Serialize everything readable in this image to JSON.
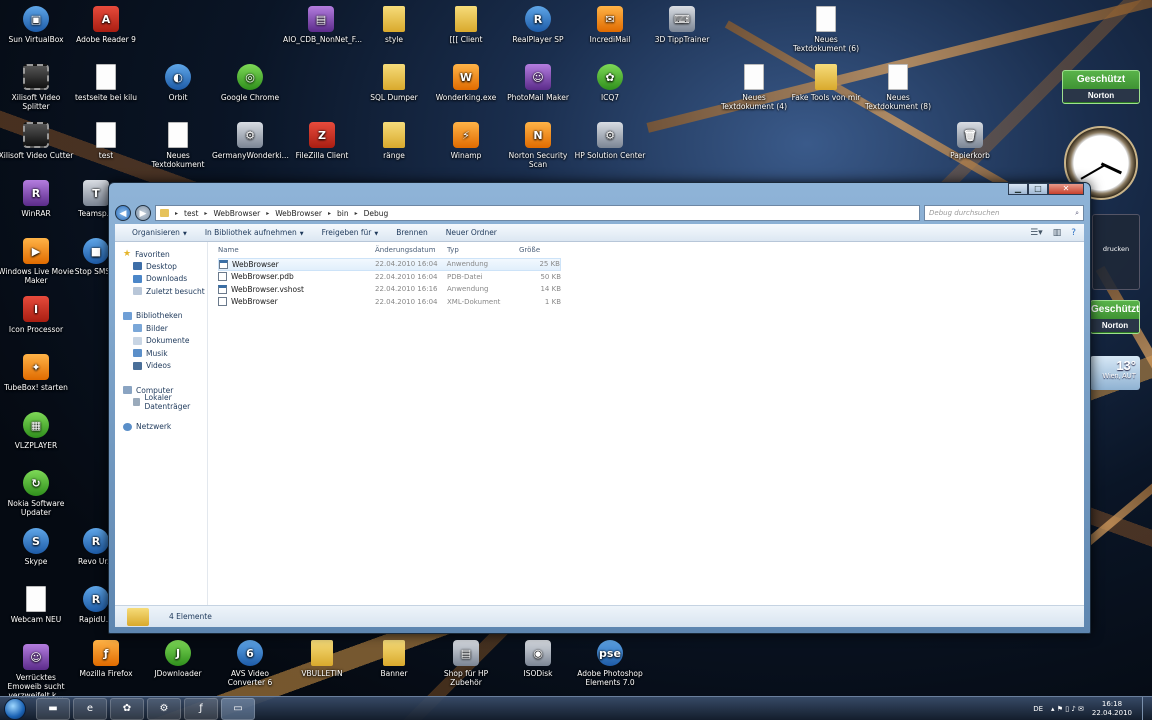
{
  "desktop": {
    "icons_top": [
      {
        "label": "Sun VirtualBox",
        "style": "blue",
        "glyph": "▣"
      },
      {
        "label": "Adobe Reader 9",
        "style": "red",
        "glyph": "A"
      },
      {
        "label": "AIO_CDB_NonNet_F...",
        "style": "purple",
        "glyph": "▤"
      },
      {
        "label": "style",
        "style": "folder",
        "glyph": ""
      },
      {
        "label": "[[[ Client",
        "style": "folder",
        "glyph": ""
      },
      {
        "label": "RealPlayer SP",
        "style": "blue",
        "glyph": "R"
      },
      {
        "label": "IncrediMail",
        "style": "orange",
        "glyph": "✉"
      },
      {
        "label": "3D TippTrainer",
        "style": "gray",
        "glyph": "⌨"
      },
      {
        "label": "Neues Textdokument (6)",
        "style": "doc",
        "glyph": ""
      }
    ],
    "icons_row2": [
      {
        "label": "Xilisoft Video Splitter",
        "style": "film",
        "glyph": ""
      },
      {
        "label": "testseite bei kilu",
        "style": "doc",
        "glyph": ""
      },
      {
        "label": "Orbit",
        "style": "blue",
        "glyph": "◐"
      },
      {
        "label": "Google Chrome",
        "style": "green",
        "glyph": "◎"
      },
      {
        "label": "SQL Dumper",
        "style": "folder",
        "glyph": ""
      },
      {
        "label": "Wonderking.exe",
        "style": "orange",
        "glyph": "W"
      },
      {
        "label": "PhotoMail Maker",
        "style": "purple",
        "glyph": "☺"
      },
      {
        "label": "ICQ7",
        "style": "green",
        "glyph": "✿"
      },
      {
        "label": "Neues Textdokument (4)",
        "style": "doc",
        "glyph": ""
      },
      {
        "label": "Fake Tools von mir",
        "style": "folder",
        "glyph": ""
      },
      {
        "label": "Neues Textdokument (8)",
        "style": "doc",
        "glyph": ""
      }
    ],
    "icons_row3": [
      {
        "label": "Xilisoft Video Cutter",
        "style": "film",
        "glyph": ""
      },
      {
        "label": "test",
        "style": "doc",
        "glyph": ""
      },
      {
        "label": "Neues Textdokument",
        "style": "doc",
        "glyph": ""
      },
      {
        "label": "GermanyWonderki...",
        "style": "gray",
        "glyph": "⚙"
      },
      {
        "label": "FileZilla Client",
        "style": "red",
        "glyph": "Z"
      },
      {
        "label": "ränge",
        "style": "folder",
        "glyph": ""
      },
      {
        "label": "Winamp",
        "style": "orange",
        "glyph": "⚡"
      },
      {
        "label": "Norton Security Scan",
        "style": "orange",
        "glyph": "N"
      },
      {
        "label": "HP Solution Center",
        "style": "gray",
        "glyph": "⚙"
      },
      {
        "label": "Papierkorb",
        "style": "gray",
        "glyph": "🗑"
      }
    ],
    "icons_left": [
      {
        "label": "WinRAR",
        "style": "purple",
        "glyph": "R"
      },
      {
        "label": "Windows Live Movie Maker",
        "style": "orange",
        "glyph": "▶"
      },
      {
        "label": "Icon Processor",
        "style": "red",
        "glyph": "I"
      },
      {
        "label": "TubeBox! starten",
        "style": "orange",
        "glyph": "✦"
      },
      {
        "label": "VLZPLAYER",
        "style": "green",
        "glyph": "▦"
      },
      {
        "label": "Nokia Software Updater",
        "style": "green",
        "glyph": "↻"
      },
      {
        "label": "Skype",
        "style": "blue",
        "glyph": "S"
      },
      {
        "label": "Webcam NEU",
        "style": "doc",
        "glyph": ""
      },
      {
        "label": "Verrücktes Emoweib sucht verzweifelt k...",
        "style": "purple",
        "glyph": "☺"
      }
    ],
    "icons_left2": [
      {
        "label": "Teamsp...",
        "style": "gray",
        "glyph": "T"
      },
      {
        "label": "Stop SMS...",
        "style": "blue",
        "glyph": "■"
      },
      {
        "label": "Revo Ur...",
        "style": "blue",
        "glyph": "R"
      },
      {
        "label": "RapidU...",
        "style": "blue",
        "glyph": "R"
      }
    ],
    "icons_bottom": [
      {
        "label": "Mozilla Firefox",
        "style": "orange",
        "glyph": "ƒ"
      },
      {
        "label": "JDownloader",
        "style": "green",
        "glyph": "J"
      },
      {
        "label": "AVS Video Converter 6",
        "style": "blue",
        "glyph": "6"
      },
      {
        "label": "VBULLETIN",
        "style": "folder",
        "glyph": ""
      },
      {
        "label": "Banner",
        "style": "folder",
        "glyph": ""
      },
      {
        "label": "Shop für HP Zubehör",
        "style": "gray",
        "glyph": "▤"
      },
      {
        "label": "ISODisk",
        "style": "gray",
        "glyph": "◉"
      },
      {
        "label": "Adobe Photoshop Elements 7.0",
        "style": "blue",
        "glyph": "pse"
      }
    ]
  },
  "gadgets": {
    "norton1": {
      "status": "Geschützt",
      "brand": "Norton"
    },
    "norton2": {
      "status": "Geschützt",
      "brand": "Norton"
    },
    "weather": {
      "temp": "13°",
      "city": "Wien, AUT"
    },
    "print_label": "drucken"
  },
  "explorer": {
    "breadcrumb": [
      "test",
      "WebBrowser",
      "WebBrowser",
      "bin",
      "Debug"
    ],
    "search_placeholder": "Debug durchsuchen",
    "toolbar": [
      {
        "label": "Organisieren",
        "dropdown": true
      },
      {
        "label": "In Bibliothek aufnehmen",
        "dropdown": true
      },
      {
        "label": "Freigeben für",
        "dropdown": true
      },
      {
        "label": "Brennen",
        "dropdown": false
      },
      {
        "label": "Neuer Ordner",
        "dropdown": false
      }
    ],
    "nav": {
      "favorites": "Favoriten",
      "favorites_items": [
        "Desktop",
        "Downloads",
        "Zuletzt besucht"
      ],
      "libraries": "Bibliotheken",
      "libraries_items": [
        "Bilder",
        "Dokumente",
        "Musik",
        "Videos"
      ],
      "computer": "Computer",
      "computer_items": [
        "Lokaler Datenträger"
      ],
      "network": "Netzwerk"
    },
    "columns": {
      "name": "Name",
      "date": "Änderungsdatum",
      "type": "Typ",
      "size": "Größe"
    },
    "files": [
      {
        "name": "WebBrowser",
        "date": "22.04.2010 16:04",
        "type": "Anwendung",
        "size": "25 KB",
        "icon": "exe",
        "selected": true
      },
      {
        "name": "WebBrowser.pdb",
        "date": "22.04.2010 16:04",
        "type": "PDB-Datei",
        "size": "50 KB",
        "icon": "doc",
        "selected": false
      },
      {
        "name": "WebBrowser.vshost",
        "date": "22.04.2010 16:16",
        "type": "Anwendung",
        "size": "14 KB",
        "icon": "exe",
        "selected": false
      },
      {
        "name": "WebBrowser",
        "date": "22.04.2010 16:04",
        "type": "XML-Dokument",
        "size": "1 KB",
        "icon": "doc",
        "selected": false
      }
    ],
    "status": "4 Elemente"
  },
  "taskbar": {
    "language": "DE",
    "time": "16:18",
    "date": "22.04.2010"
  }
}
